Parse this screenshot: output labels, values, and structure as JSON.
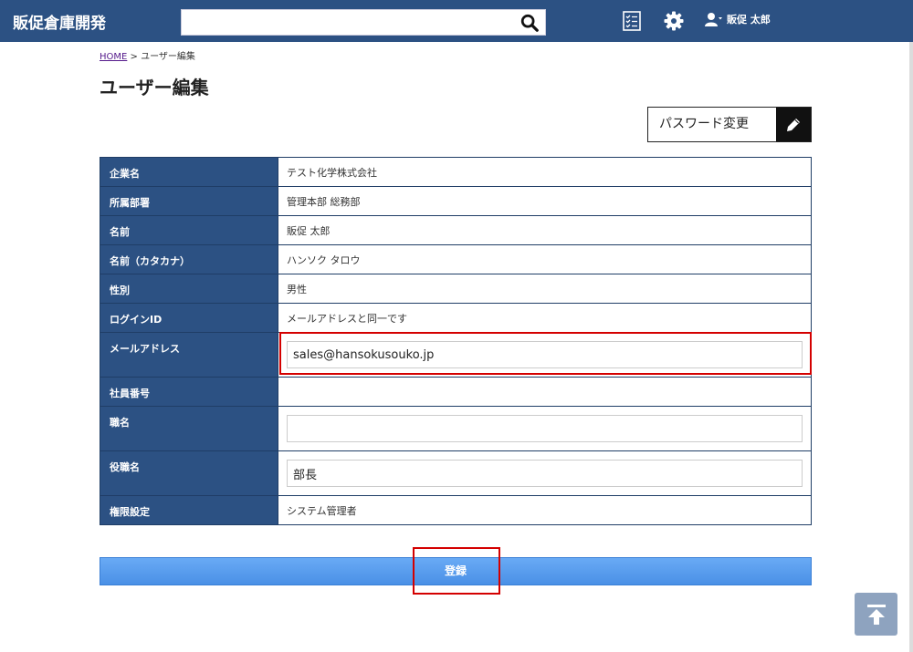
{
  "header": {
    "brand": "販促倉庫開発",
    "search": {
      "value": "",
      "placeholder": ""
    },
    "user_name": "販促 太郎"
  },
  "breadcrumb": {
    "home": "HOME",
    "separator": " > ",
    "current": "ユーザー編集"
  },
  "page_title": "ユーザー編集",
  "password_button": {
    "label": "パスワード変更"
  },
  "form": {
    "rows": [
      {
        "label": "企業名",
        "value": "テスト化学株式会社"
      },
      {
        "label": "所属部署",
        "value": "管理本部 総務部"
      },
      {
        "label": "名前",
        "value": "販促 太郎"
      },
      {
        "label": "名前（カタカナ）",
        "value": "ハンソク タロウ"
      },
      {
        "label": "性別",
        "value": "男性"
      },
      {
        "label": "ログインID",
        "value": "メールアドレスと同一です"
      },
      {
        "label": "メールアドレス",
        "value": "sales@hansokusouko.jp"
      },
      {
        "label": "社員番号",
        "value": ""
      },
      {
        "label": "職名",
        "value": ""
      },
      {
        "label": "役職名",
        "value": "部長"
      },
      {
        "label": "権限設定",
        "value": "システム管理者"
      }
    ]
  },
  "submit_label": "登録",
  "colors": {
    "header": "#2c5183",
    "highlight": "#d40000",
    "button": "#4a90e6"
  },
  "icons": [
    "search-icon",
    "checklist-icon",
    "gear-icon",
    "user-icon",
    "pencil-icon",
    "back-to-top-icon"
  ]
}
